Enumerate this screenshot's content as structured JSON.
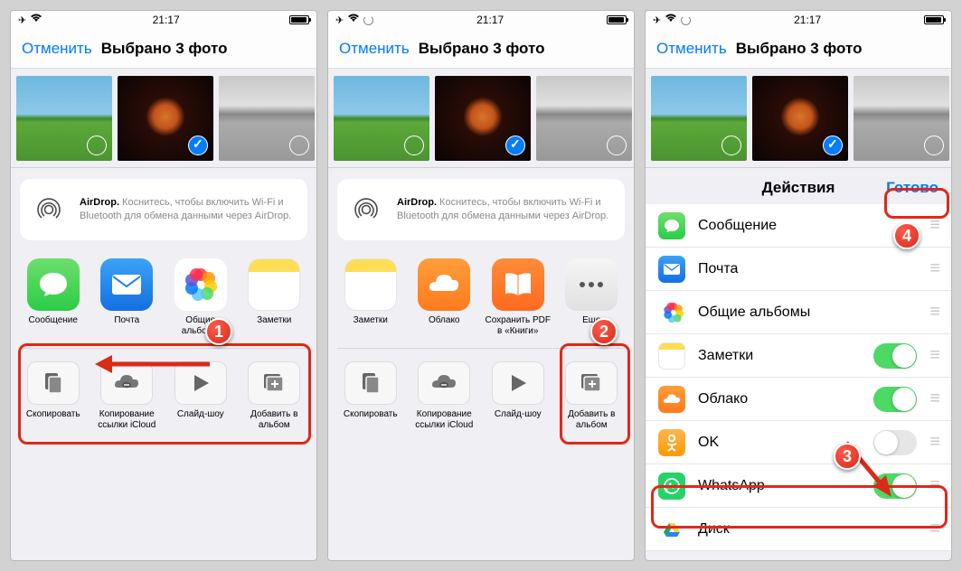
{
  "status": {
    "time": "21:17"
  },
  "nav": {
    "cancel": "Отменить",
    "title": "Выбрано 3 фото"
  },
  "airdrop": {
    "bold": "AirDrop.",
    "text": " Коснитесь, чтобы включить Wi-Fi и Bluetooth для обмена данными через AirDrop."
  },
  "screen1": {
    "apps": [
      {
        "label": "Сообщение",
        "icon": "msg"
      },
      {
        "label": "Почта",
        "icon": "mail"
      },
      {
        "label": "Общие альбомы",
        "icon": "photos"
      },
      {
        "label": "Заметки",
        "icon": "notes"
      }
    ],
    "actions": [
      {
        "label": "Скопировать",
        "glyph": "⿻"
      },
      {
        "label": "Копирование ссылки iCloud",
        "glyph": "🔗"
      },
      {
        "label": "Слайд-шоу",
        "glyph": "▶"
      },
      {
        "label": "Добавить в альбом",
        "glyph": "⊞"
      }
    ]
  },
  "screen2": {
    "apps": [
      {
        "label": "Заметки",
        "icon": "notes"
      },
      {
        "label": "Облако",
        "icon": "cloud"
      },
      {
        "label": "Сохранить PDF в «Книги»",
        "icon": "books"
      },
      {
        "label": "Еще",
        "icon": "more"
      }
    ],
    "actions": [
      {
        "label": "Скопировать",
        "glyph": "⿻"
      },
      {
        "label": "Копирование ссылки iCloud",
        "glyph": "🔗"
      },
      {
        "label": "Слайд-шоу",
        "glyph": "▶"
      },
      {
        "label": "Добавить в альбом",
        "glyph": "⊞"
      }
    ]
  },
  "screen3": {
    "title": "Действия",
    "done": "Готово",
    "rows": [
      {
        "label": "Сообщение",
        "icon": "msg",
        "toggle": null
      },
      {
        "label": "Почта",
        "icon": "mail",
        "toggle": null
      },
      {
        "label": "Общие альбомы",
        "icon": "photos",
        "toggle": null
      },
      {
        "label": "Заметки",
        "icon": "notes",
        "toggle": "on"
      },
      {
        "label": "Облако",
        "icon": "cloud",
        "toggle": "on"
      },
      {
        "label": "OK",
        "icon": "ok",
        "toggle": "off"
      },
      {
        "label": "WhatsApp",
        "icon": "wa",
        "toggle": "on"
      },
      {
        "label": "Диск",
        "icon": "drive",
        "toggle": null
      }
    ]
  },
  "callouts": {
    "c1": "1",
    "c2": "2",
    "c3": "3",
    "c4": "4"
  }
}
